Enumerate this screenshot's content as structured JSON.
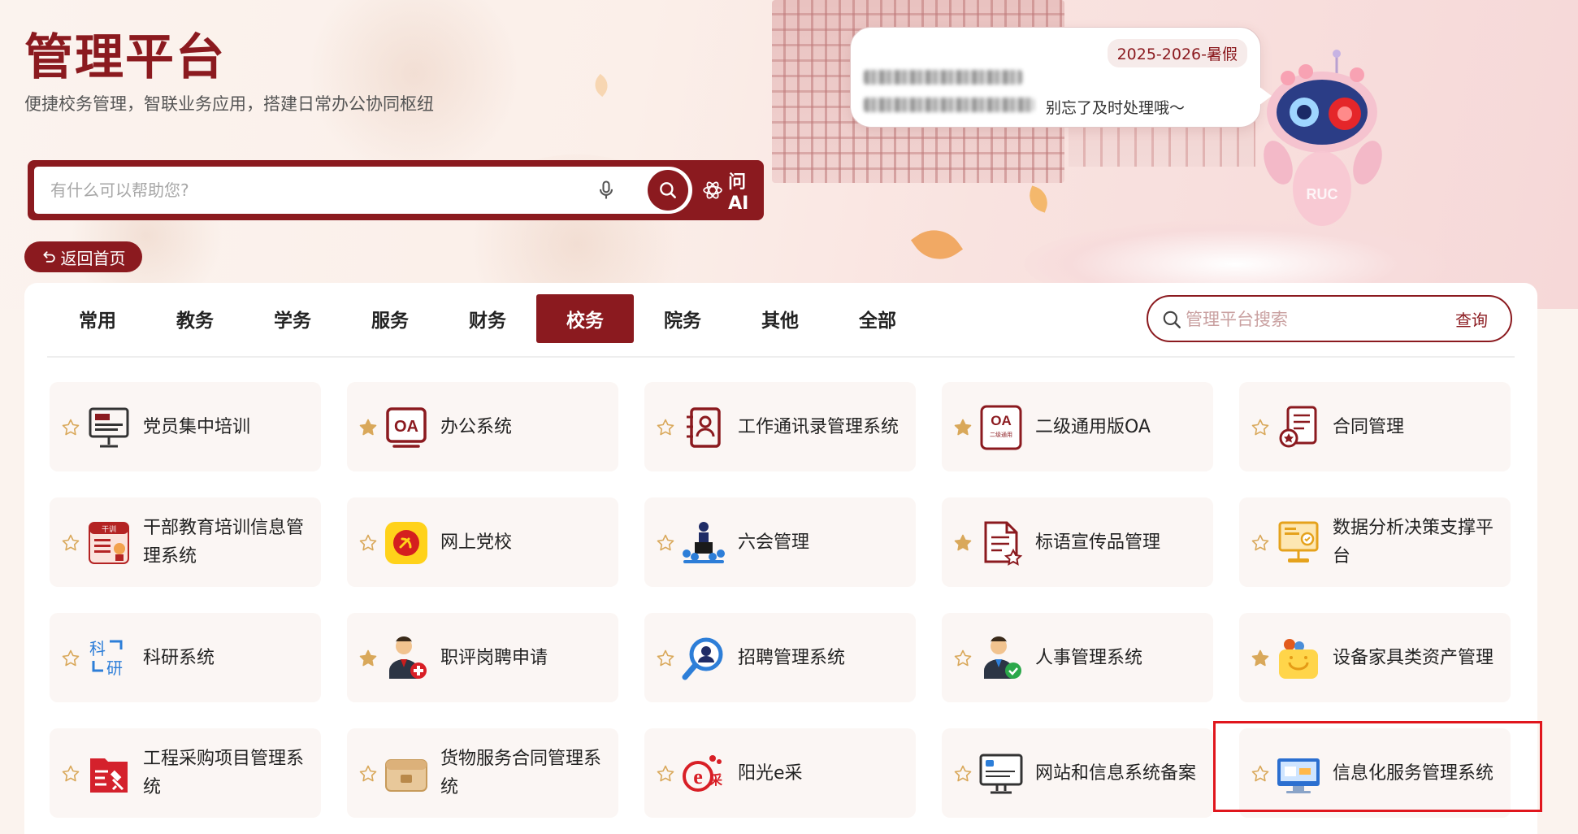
{
  "header": {
    "title": "管理平台",
    "subtitle": "便捷校务管理，智联业务应用，搭建日常办公协同枢纽",
    "search_placeholder": "有什么可以帮助您?",
    "ask_ai_label": "问AI",
    "back_home_label": "返回首页"
  },
  "notice": {
    "term": "2025-2026-暑假",
    "text": "别忘了及时处理哦～"
  },
  "robot": {
    "label": "RUC"
  },
  "tabs": [
    {
      "label": "常用",
      "active": false
    },
    {
      "label": "教务",
      "active": false
    },
    {
      "label": "学务",
      "active": false
    },
    {
      "label": "服务",
      "active": false
    },
    {
      "label": "财务",
      "active": false
    },
    {
      "label": "校务",
      "active": true
    },
    {
      "label": "院务",
      "active": false
    },
    {
      "label": "其他",
      "active": false
    },
    {
      "label": "全部",
      "active": false
    }
  ],
  "platform_search": {
    "placeholder": "管理平台搜索",
    "button_label": "查询"
  },
  "apps": [
    {
      "label": "党员集中培训",
      "favorite": false,
      "icon": "monitor-training-icon"
    },
    {
      "label": "办公系统",
      "favorite": true,
      "icon": "oa-icon",
      "icon_text": "OA"
    },
    {
      "label": "工作通讯录管理系统",
      "favorite": false,
      "icon": "contacts-book-icon"
    },
    {
      "label": "二级通用版OA",
      "favorite": true,
      "icon": "oa-secondary-icon",
      "icon_text": "OA",
      "icon_subtext": "二级通用"
    },
    {
      "label": "合同管理",
      "favorite": false,
      "icon": "contract-icon"
    },
    {
      "label": "干部教育培训信息管理系统",
      "favorite": false,
      "icon": "cadre-training-icon",
      "icon_text": "干训"
    },
    {
      "label": "网上党校",
      "favorite": false,
      "icon": "party-school-icon"
    },
    {
      "label": "六会管理",
      "favorite": false,
      "icon": "meeting-icon"
    },
    {
      "label": "标语宣传品管理",
      "favorite": true,
      "icon": "document-star-icon"
    },
    {
      "label": "数据分析决策支撑平台",
      "favorite": false,
      "icon": "data-analysis-icon"
    },
    {
      "label": "科研系统",
      "favorite": false,
      "icon": "research-icon",
      "icon_text": "科研"
    },
    {
      "label": "职评岗聘申请",
      "favorite": true,
      "icon": "title-evaluation-icon"
    },
    {
      "label": "招聘管理系统",
      "favorite": false,
      "icon": "recruitment-search-icon"
    },
    {
      "label": "人事管理系统",
      "favorite": false,
      "icon": "personnel-icon"
    },
    {
      "label": "设备家具类资产管理",
      "favorite": true,
      "icon": "asset-box-icon"
    },
    {
      "label": "工程采购项目管理系统",
      "favorite": false,
      "icon": "engineering-procurement-icon"
    },
    {
      "label": "货物服务合同管理系统",
      "favorite": false,
      "icon": "goods-contract-icon"
    },
    {
      "label": "阳光e采",
      "favorite": false,
      "icon": "e-procurement-icon",
      "icon_text": "e采"
    },
    {
      "label": "网站和信息系统备案",
      "favorite": false,
      "icon": "website-filing-icon"
    },
    {
      "label": "信息化服务管理系统",
      "favorite": false,
      "icon": "it-service-icon"
    }
  ],
  "colors": {
    "brand": "#8b1a1f",
    "card_bg": "#fbf6f4",
    "star_empty": "#d9a85a",
    "star_filled": "#d9a85a",
    "highlight": "#e0161d"
  }
}
